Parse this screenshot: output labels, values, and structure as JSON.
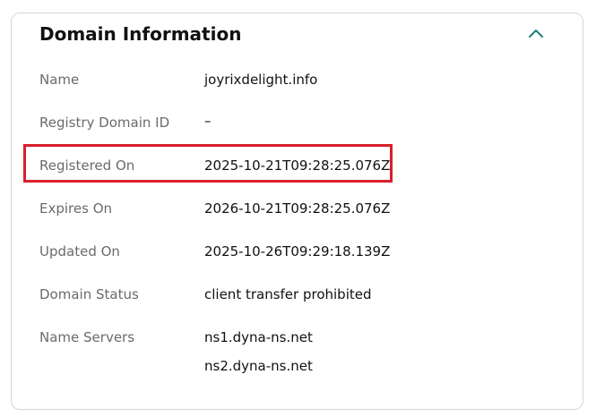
{
  "card": {
    "title": "Domain Information",
    "collapse_icon": "chevron-up-icon",
    "accent_color": "#1b7f7a",
    "highlight_color": "#d8202a"
  },
  "rows": [
    {
      "label": "Name",
      "value": "joyrixdelight.info"
    },
    {
      "label": "Registry Domain ID",
      "value": "–"
    },
    {
      "label": "Registered On",
      "value": "2025-10-21T09:28:25.076Z"
    },
    {
      "label": "Expires On",
      "value": "2026-10-21T09:28:25.076Z"
    },
    {
      "label": "Updated On",
      "value": "2025-10-26T09:29:18.139Z"
    },
    {
      "label": "Domain Status",
      "value": "client transfer prohibited"
    },
    {
      "label": "Name Servers",
      "values": [
        "ns1.dyna-ns.net",
        "ns2.dyna-ns.net"
      ]
    }
  ]
}
